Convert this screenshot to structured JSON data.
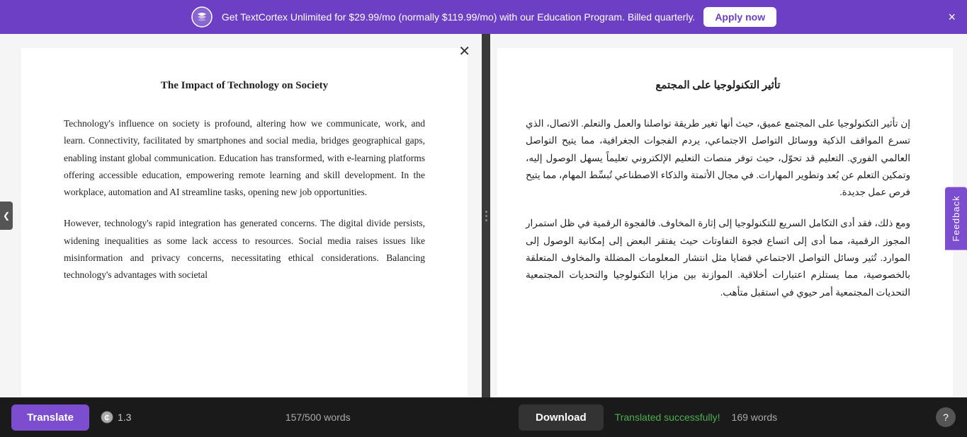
{
  "banner": {
    "text": "Get TextCortex Unlimited for $29.99/mo (normally $119.99/mo) with our Education Program. Billed quarterly.",
    "apply_label": "Apply now",
    "close_label": "×"
  },
  "left_doc": {
    "title": "The Impact of Technology on Society",
    "para1": "Technology's influence on society is profound, altering how we communicate, work, and learn. Connectivity, facilitated by smartphones and social media, bridges geographical gaps, enabling instant global communication. Education has transformed, with e-learning platforms offering accessible education, empowering remote learning and skill development. In the workplace, automation and AI streamline tasks, opening new job opportunities.",
    "para2": "However, technology's rapid integration has generated concerns. The digital divide persists, widening inequalities as some lack access to resources. Social media raises issues like misinformation and privacy concerns, necessitating ethical considerations. Balancing technology's advantages with societal"
  },
  "right_doc": {
    "title": "تأثير التكنولوجيا على المجتمع",
    "para1": "إن تأثير التكنولوجيا على المجتمع عميق، حيث أنها تغير طريقة تواصلنا والعمل والتعلم. الاتصال، الذي تسرع المواقف الذكية ووسائل التواصل الاجتماعي، يردم الفجوات الجغرافية، مما يتيح التواصل العالمي الفوري. التعليم قد تحوّل، حيث توفر منصات التعليم الإلكتروني تعليماً يسهل الوصول إليه، وتمكين التعلم عن بُعد وتطوير المهارات. في مجال الأتمتة والذكاء الاصطناعي تُبسِّط المهام، مما يتيح فرص عمل جديدة.",
    "para2": "ومع ذلك، فقد أدى التكامل السريع للتكنولوجيا إلى إثارة المخاوف. فالفجوة الرقمية في ظل استمرار المجوز الرقمية، مما أدى إلى اتساع فجوة التفاوتات حيث يفتقر البعض إلى إمكانية الوصول إلى الموارد. تُثير وسائل التواصل الاجتماعي قضايا مثل انتشار المعلومات المضللة والمخاوف المتعلقة بالخصوصية، مما يستلزم اعتبارات أخلاقية. الموازنة بين مزايا التكنولوجيا والتحديات المجتمعية التحديات المجتمعية أمر حيوي في استقبل متأهب."
  },
  "bottom": {
    "translate_label": "Translate",
    "credits": "1.3",
    "words_left": "157/500 words",
    "download_label": "Download",
    "success_text": "Translated successfully!",
    "words_right": "169 words",
    "help_label": "?",
    "toggle_label": "❮"
  },
  "feedback": {
    "label": "Feedback"
  }
}
